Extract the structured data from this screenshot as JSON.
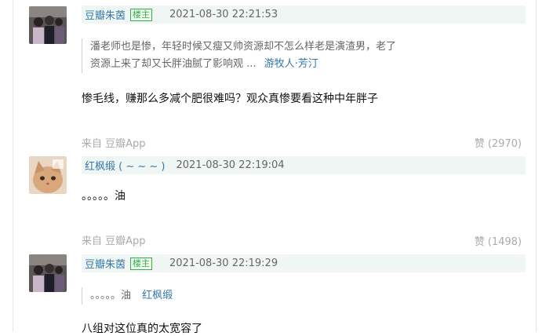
{
  "comments": [
    {
      "username": "豆瓣朱茵",
      "badge": "楼主",
      "time": "2021-08-30 22:21:53",
      "quote_line1": "潘老师也是惨，年轻时候又瘦又帅资源却不怎么样老是演渣男，老了",
      "quote_line2": "资源上来了却又长胖油腻了影响观 ...",
      "quote_author": "游牧人·芳汀",
      "content": "惨毛线，赚那么多减个肥很难吗？观众真惨要看这种中年胖子",
      "source": "来自 豆瓣App",
      "like_label": "赞",
      "like_count": "(2970)"
    },
    {
      "username": "红枫缎 ( ~ ~ ~ )",
      "time": "2021-08-30 22:19:04",
      "content": "。。。。。油",
      "source": "来自 豆瓣App",
      "like_label": "赞",
      "like_count": "(1498)"
    },
    {
      "username": "豆瓣朱茵",
      "badge": "楼主",
      "time": "2021-08-30 22:19:29",
      "quote_line1": "。。。。。油",
      "quote_author": "红枫缎",
      "content": "八组对这位真的太宽容了"
    }
  ]
}
